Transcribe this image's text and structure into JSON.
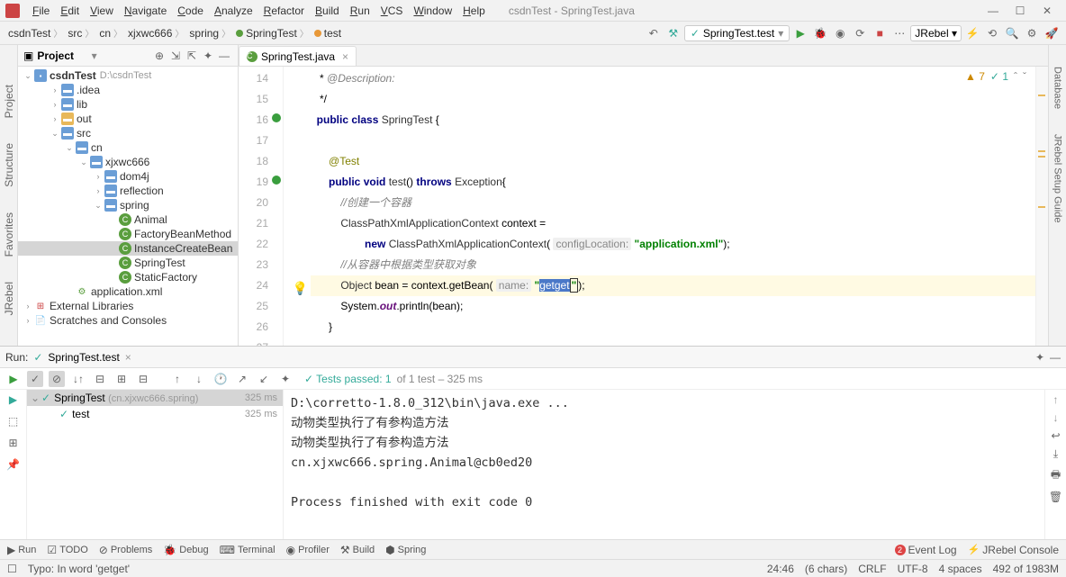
{
  "window": {
    "title": "csdnTest - SpringTest.java"
  },
  "menu": [
    "File",
    "Edit",
    "View",
    "Navigate",
    "Code",
    "Analyze",
    "Refactor",
    "Build",
    "Run",
    "VCS",
    "Window",
    "Help"
  ],
  "breadcrumbs": [
    "csdnTest",
    "src",
    "cn",
    "xjxwc666",
    "spring",
    "SpringTest",
    "test"
  ],
  "run_config": "SpringTest.test",
  "project": {
    "title": "Project",
    "root": "csdnTest",
    "root_hint": "D:\\csdnTest",
    "items": [
      {
        "indent": 1,
        "arrow": "›",
        "icon": "folder",
        "label": ".idea"
      },
      {
        "indent": 1,
        "arrow": "›",
        "icon": "folder",
        "label": "lib"
      },
      {
        "indent": 1,
        "arrow": "›",
        "icon": "folder-y",
        "label": "out"
      },
      {
        "indent": 1,
        "arrow": "⌄",
        "icon": "folder",
        "label": "src"
      },
      {
        "indent": 2,
        "arrow": "⌄",
        "icon": "folder",
        "label": "cn"
      },
      {
        "indent": 3,
        "arrow": "⌄",
        "icon": "folder",
        "label": "xjxwc666"
      },
      {
        "indent": 4,
        "arrow": "›",
        "icon": "folder",
        "label": "dom4j"
      },
      {
        "indent": 4,
        "arrow": "›",
        "icon": "folder",
        "label": "reflection"
      },
      {
        "indent": 4,
        "arrow": "⌄",
        "icon": "folder",
        "label": "spring"
      },
      {
        "indent": 5,
        "arrow": "",
        "icon": "cls",
        "label": "Animal"
      },
      {
        "indent": 5,
        "arrow": "",
        "icon": "cls",
        "label": "FactoryBeanMethod"
      },
      {
        "indent": 5,
        "arrow": "",
        "icon": "cls",
        "label": "InstanceCreateBean",
        "sel": true
      },
      {
        "indent": 5,
        "arrow": "",
        "icon": "cls",
        "label": "SpringTest"
      },
      {
        "indent": 5,
        "arrow": "",
        "icon": "cls",
        "label": "StaticFactory"
      },
      {
        "indent": 2,
        "arrow": "",
        "icon": "xml",
        "label": "application.xml"
      },
      {
        "indent": 0,
        "arrow": "›",
        "icon": "lib",
        "label": "External Libraries"
      },
      {
        "indent": 0,
        "arrow": "›",
        "icon": "scratch",
        "label": "Scratches and Consoles"
      }
    ]
  },
  "tabs": [
    {
      "label": "SpringTest.java"
    }
  ],
  "inspections": {
    "warnings": "7",
    "typos": "1"
  },
  "code": {
    "lines": [
      {
        "n": 14,
        "html": "   * <span class='cmt'>@Description:</span>"
      },
      {
        "n": 15,
        "html": "   */"
      },
      {
        "n": 16,
        "html": "  <span class='kw'>public</span> <span class='kw'>class</span> <span class='typ'>SpringTest</span> {",
        "run": true
      },
      {
        "n": 17,
        "html": ""
      },
      {
        "n": 18,
        "html": "      <span class='ann'>@Test</span>"
      },
      {
        "n": 19,
        "html": "      <span class='kw'>public</span> <span class='kw'>void</span> <span class='mth'>test</span>() <span class='kw'>throws</span> <span class='typ'>Exception</span>{",
        "run": true
      },
      {
        "n": 20,
        "html": "          <span class='cmt'>//创建一个容器</span>"
      },
      {
        "n": 21,
        "html": "          <span class='typ'>ClassPathXmlApplicationContext</span> context ="
      },
      {
        "n": 22,
        "html": "                  <span class='kw'>new</span> <span class='typ'>ClassPathXmlApplicationContext</span>( <span class='hint'>configLocation:</span> <span class='str'>\"application.xml\"</span>);"
      },
      {
        "n": 23,
        "html": "          <span class='cmt'>//从容器中根据类型获取对象</span>"
      },
      {
        "n": 24,
        "html": "          <span class='typ'>Object</span> bean = context.getBean( <span class='hint'>name:</span> <span class='str'>\"</span><span class='sel'>getget</span><span class='caret str'>\"</span>);",
        "active": true,
        "bulb": true
      },
      {
        "n": 25,
        "html": "          System.<span class='fld'>out</span>.println(bean);"
      },
      {
        "n": 26,
        "html": "      }"
      },
      {
        "n": 27,
        "html": ""
      }
    ]
  },
  "run": {
    "title": "Run:",
    "config": "SpringTest.test",
    "tests_passed_label": "Tests passed: 1",
    "tests_info": " of 1 test – 325 ms",
    "tree": [
      {
        "arrow": "⌄",
        "name": "SpringTest",
        "pkg": "(cn.xjxwc666.spring)",
        "time": "325 ms",
        "sel": true,
        "indent": 0
      },
      {
        "arrow": "",
        "name": "test",
        "pkg": "",
        "time": "325 ms",
        "indent": 1
      }
    ],
    "console_lines": [
      "D:\\corretto-1.8.0_312\\bin\\java.exe ...",
      "动物类型执行了有参构造方法",
      "动物类型执行了有参构造方法",
      "cn.xjxwc666.spring.Animal@cb0ed20",
      "",
      "Process finished with exit code 0"
    ]
  },
  "bottom_tabs": [
    "Run",
    "TODO",
    "Problems",
    "Debug",
    "Terminal",
    "Profiler",
    "Build",
    "Spring"
  ],
  "event_log": "Event Log",
  "jrebel_console": "JRebel Console",
  "status": {
    "message": "Typo: In word 'getget'",
    "pos": "24:46",
    "sel": "(6 chars)",
    "eol": "CRLF",
    "enc": "UTF-8",
    "indent": "4 spaces",
    "mem": "492 of 1983M"
  },
  "side_tabs_left": [
    "Project",
    "Structure",
    "Favorites",
    "JRebel"
  ],
  "side_tabs_right": [
    "Database",
    "JRebel Setup Guide"
  ]
}
